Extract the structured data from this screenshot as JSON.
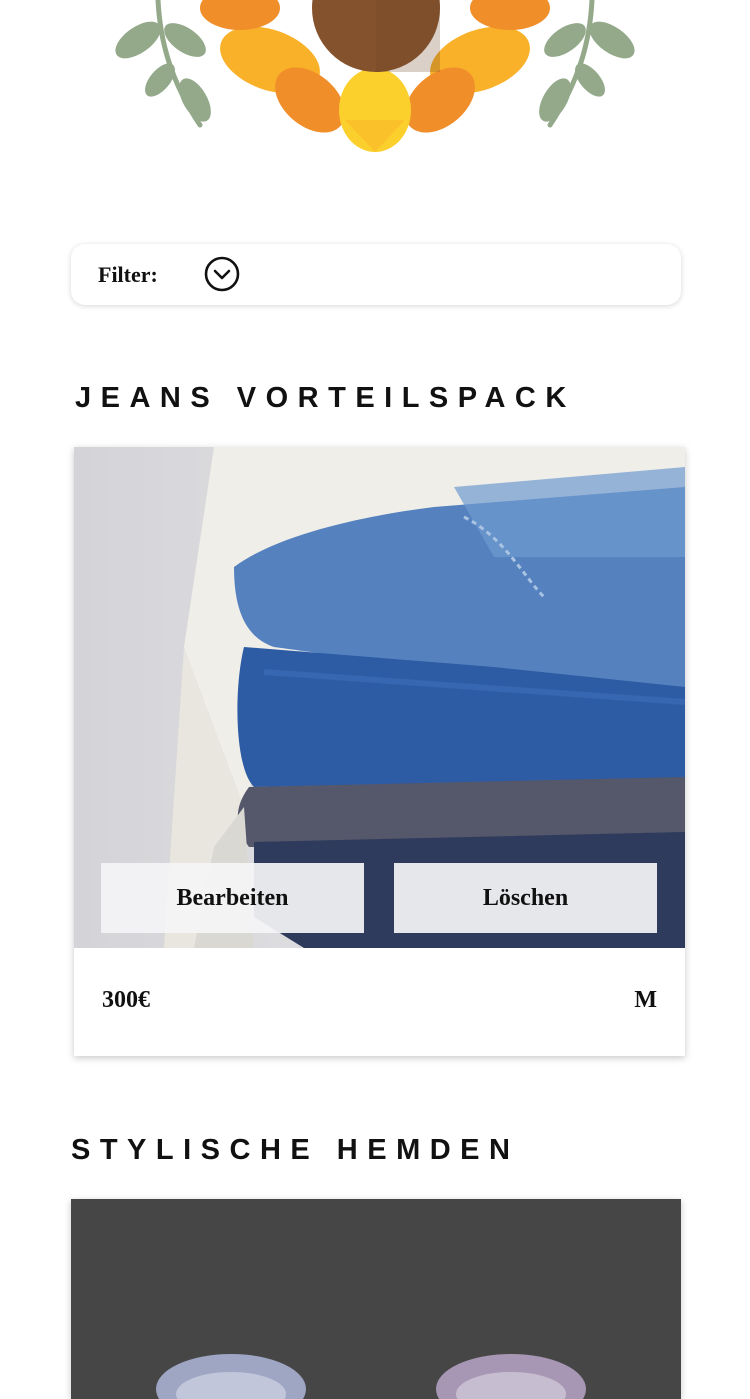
{
  "header": {
    "decoration_icon": "sunflower-icon"
  },
  "filter": {
    "label": "Filter:",
    "toggle_icon": "chevron-down-circle-icon"
  },
  "products": [
    {
      "title": "JEANS VORTEILSPACK",
      "image_icon": "folded-jeans-photo",
      "edit_label": "Bearbeiten",
      "delete_label": "Löschen",
      "price": "300€",
      "size": "M"
    },
    {
      "title": "STYLISCHE HEMDEN",
      "image_icon": "shirts-photo"
    }
  ],
  "colors": {
    "background": "#ffffff",
    "petal": "#f9b12a",
    "petal_dark": "#f08e2a",
    "sunflower_center": "#84522c",
    "leaf": "#93a98a",
    "denim_light": "#5582bf",
    "denim_mid": "#2d5ba4",
    "denim_dark": "#2e3b5c",
    "overlay_button": "#f4f4f6",
    "card2_background": "#464646"
  }
}
